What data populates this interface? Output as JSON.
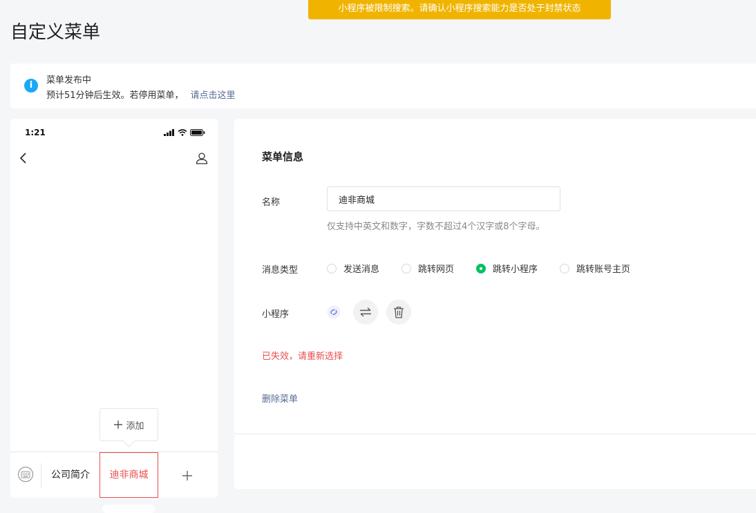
{
  "banner": {
    "text": "小程序被限制搜索。请确认小程序搜索能力是否处于封禁状态"
  },
  "page": {
    "title": "自定义菜单"
  },
  "notice": {
    "title": "菜单发布中",
    "text": "预计51分钟后生效。若停用菜单，",
    "link": "请点击这里"
  },
  "phone": {
    "time": "1:21",
    "menu_items": [
      "公司简介",
      "迪非商城"
    ],
    "add_label": "添加"
  },
  "form": {
    "section_title": "菜单信息",
    "name_label": "名称",
    "name_value": "迪非商城",
    "name_hint": "仅支持中英文和数字，字数不超过4个汉字或8个字母。",
    "type_label": "消息类型",
    "types": [
      "发送消息",
      "跳转网页",
      "跳转小程序",
      "跳转账号主页"
    ],
    "selected_type": "跳转小程序",
    "mp_label": "小程序",
    "expired_text": "已失效，请重新选择",
    "delete_label": "删除菜单"
  },
  "colors": {
    "banner": "#f0b400",
    "accent_green": "#07c160",
    "error_red": "#e84e4e",
    "link": "#576b95",
    "info_blue": "#1aa8f7"
  },
  "icons": [
    "info-icon",
    "signal-icon",
    "wifi-icon",
    "battery-icon",
    "back-icon",
    "user-icon",
    "keyboard-icon",
    "plus-icon",
    "link-icon",
    "swap-icon",
    "trash-icon"
  ]
}
